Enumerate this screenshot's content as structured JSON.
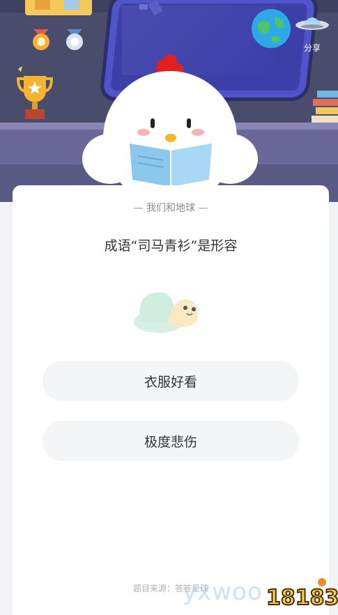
{
  "header": {
    "share_label": "分享"
  },
  "quiz": {
    "category": "— 我们和地球 —",
    "question": "成语“司马青衫”是形容",
    "options": [
      {
        "label": "衣服好看"
      },
      {
        "label": "极度悲伤"
      }
    ]
  },
  "footer": {
    "source": "题目来源：答答星球"
  },
  "watermark": {
    "text": "yxwoo",
    "logo_text": "18183"
  },
  "colors": {
    "scene_bg": "#4a4c6b",
    "window": "#3c3fa8",
    "card_bg": "#ffffff",
    "option_bg": "#f4f5f7",
    "mascot_comb": "#e02020"
  }
}
